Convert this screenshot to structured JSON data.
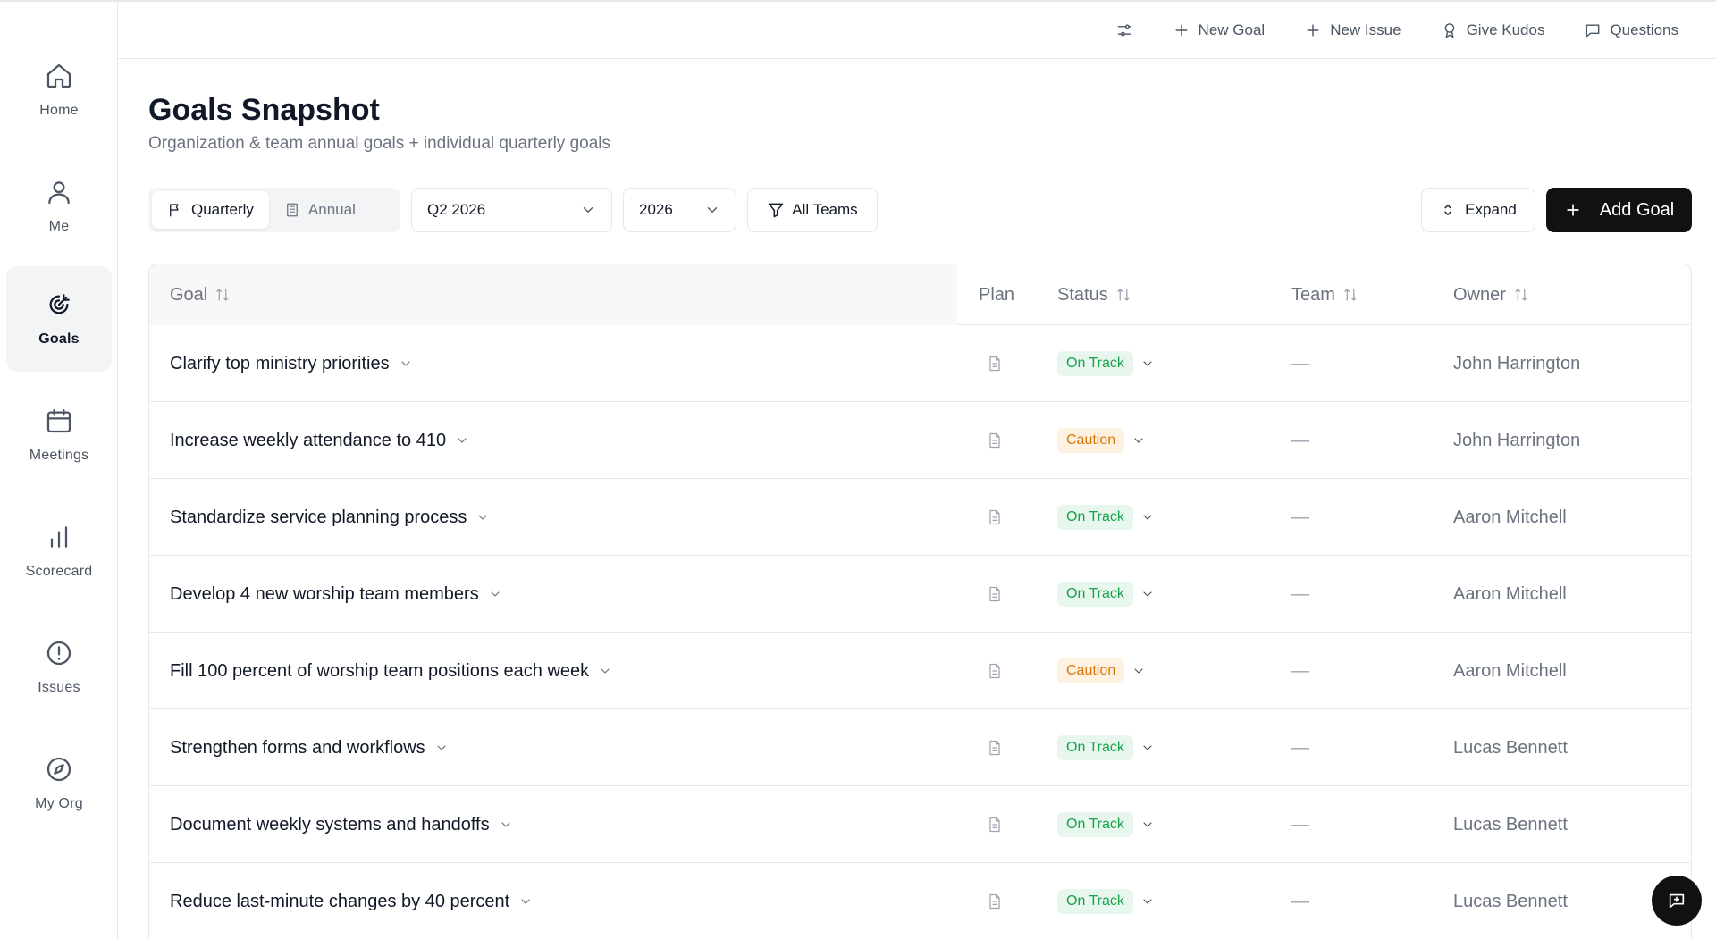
{
  "sidebar": {
    "items": [
      {
        "label": "Home",
        "icon": "home-icon"
      },
      {
        "label": "Me",
        "icon": "user-icon"
      },
      {
        "label": "Goals",
        "icon": "target-icon",
        "active": true
      },
      {
        "label": "Meetings",
        "icon": "calendar-icon"
      },
      {
        "label": "Scorecard",
        "icon": "bar-chart-icon"
      },
      {
        "label": "Issues",
        "icon": "alert-circle-icon"
      },
      {
        "label": "My Org",
        "icon": "compass-icon"
      }
    ]
  },
  "topbar": {
    "new_goal": "New Goal",
    "new_issue": "New Issue",
    "give_kudos": "Give Kudos",
    "questions": "Questions"
  },
  "header": {
    "title": "Goals Snapshot",
    "subtitle": "Organization & team annual goals + individual quarterly goals"
  },
  "controls": {
    "quarterly": "Quarterly",
    "annual": "Annual",
    "quarter_select": "Q2 2026",
    "year_select": "2026",
    "teams_filter": "All Teams",
    "expand": "Expand",
    "add_goal": "Add Goal"
  },
  "table": {
    "columns": {
      "goal": "Goal",
      "plan": "Plan",
      "status": "Status",
      "team": "Team",
      "owner": "Owner"
    },
    "rows": [
      {
        "goal": "Clarify top ministry priorities",
        "status": "On Track",
        "team": "—",
        "owner": "John Harrington"
      },
      {
        "goal": "Increase weekly attendance to 410",
        "status": "Caution",
        "team": "—",
        "owner": "John Harrington"
      },
      {
        "goal": "Standardize service planning process",
        "status": "On Track",
        "team": "—",
        "owner": "Aaron Mitchell"
      },
      {
        "goal": "Develop 4 new worship team members",
        "status": "On Track",
        "team": "—",
        "owner": "Aaron Mitchell"
      },
      {
        "goal": "Fill 100 percent of worship team positions each week",
        "status": "Caution",
        "team": "—",
        "owner": "Aaron Mitchell"
      },
      {
        "goal": "Strengthen forms and workflows",
        "status": "On Track",
        "team": "—",
        "owner": "Lucas Bennett"
      },
      {
        "goal": "Document weekly systems and handoffs",
        "status": "On Track",
        "team": "—",
        "owner": "Lucas Bennett"
      },
      {
        "goal": "Reduce last-minute changes by 40 percent",
        "status": "On Track",
        "team": "—",
        "owner": "Lucas Bennett"
      }
    ]
  },
  "colors": {
    "on_track_text": "#16a34a",
    "on_track_bg": "#e8f7ee",
    "caution_text": "#d97706",
    "caution_bg": "#fdf1e1",
    "primary_button": "#111111"
  }
}
